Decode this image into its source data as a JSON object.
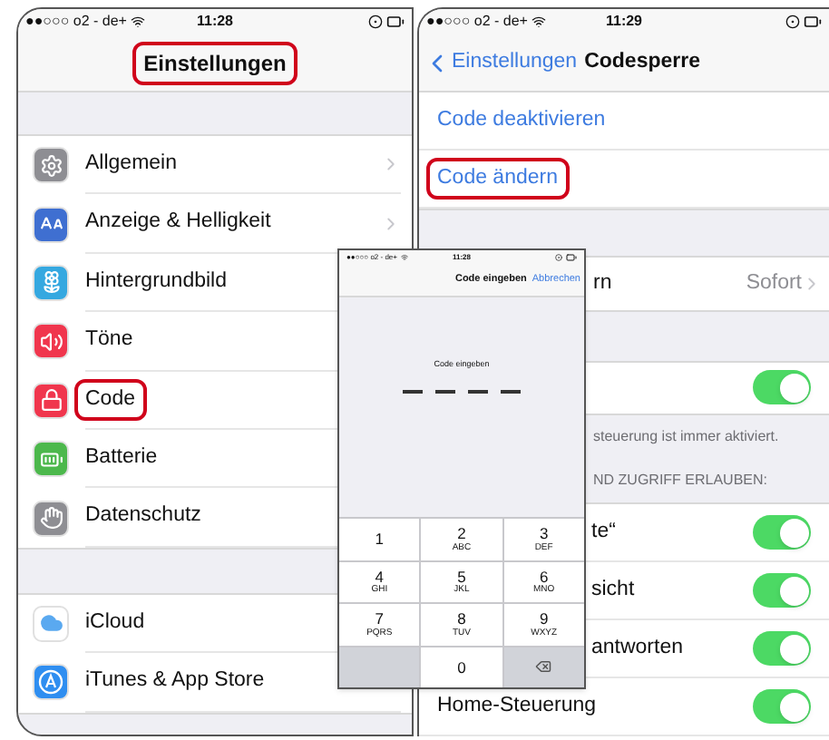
{
  "left_screen": {
    "status_bar": {
      "carrier": "●●○○○ o2 - de+",
      "time": "11:28"
    },
    "title": {
      "text": "Einstellungen",
      "highlighted": true
    },
    "sections": [
      {
        "items": [
          {
            "label": "Allgemein",
            "color": "#8e8e93",
            "chevron": true,
            "highlighted": false
          },
          {
            "label": "Anzeige & Helligkeit",
            "color": "#3f6fd1",
            "chevron": true,
            "highlighted": false
          },
          {
            "label": "Hintergrundbild",
            "color": "#35a8e0",
            "highlighted": false
          },
          {
            "label": "Töne",
            "color": "#f0364d",
            "highlighted": false
          },
          {
            "label": "Code",
            "color": "#f0364d",
            "highlighted": true
          },
          {
            "label": "Batterie",
            "color": "#4cb84c",
            "highlighted": false
          },
          {
            "label": "Datenschutz",
            "color": "#8e8e93",
            "highlighted": false
          }
        ]
      },
      {
        "items": [
          {
            "label": "iCloud",
            "color": "#ffffff",
            "highlighted": false
          },
          {
            "label": "iTunes & App Store",
            "color": "#2f8ef0",
            "highlighted": false
          }
        ]
      }
    ]
  },
  "right_screen": {
    "status_bar": {
      "carrier": "●●○○○ o2 - de+",
      "time": "11:29"
    },
    "back_label": "Einstellungen",
    "title": "Codesperre",
    "action_rows": [
      {
        "label": "Code deaktivieren",
        "highlighted": false
      },
      {
        "label": "Code ändern",
        "highlighted": true
      }
    ],
    "value_row": {
      "label": "rn",
      "value": "Sofort"
    },
    "toggle_row": {
      "on": true
    },
    "footer": "steuerung ist immer aktiviert.",
    "section_header": "ND ZUGRIFF ERLAUBEN:",
    "toggle_rows": [
      {
        "label": "te“",
        "on": true,
        "kind": "covered"
      },
      {
        "label": "sicht",
        "on": true,
        "kind": "covered"
      },
      {
        "label": "antworten",
        "on": true,
        "kind": "covered"
      },
      {
        "label": "Home-Steuerung",
        "on": true,
        "kind": "full"
      }
    ]
  },
  "code_dialog": {
    "status_bar": {
      "carrier": "●●○○○ o2 - de+",
      "time": "11:28"
    },
    "title": "Code eingeben",
    "cancel": "Abbrechen",
    "prompt": "Code eingeben",
    "code_slots": [
      {
        "filled": false
      },
      {
        "filled": false
      },
      {
        "filled": false
      },
      {
        "filled": false
      }
    ],
    "keys": [
      {
        "kind": "digit",
        "digit": "1"
      },
      {
        "kind": "digit",
        "digit": "2",
        "letters": "ABC"
      },
      {
        "kind": "digit",
        "digit": "3",
        "letters": "DEF"
      },
      {
        "kind": "digit",
        "digit": "4",
        "letters": "GHI"
      },
      {
        "kind": "digit",
        "digit": "5",
        "letters": "JKL"
      },
      {
        "kind": "digit",
        "digit": "6",
        "letters": "MNO"
      },
      {
        "kind": "digit",
        "digit": "7",
        "letters": "PQRS"
      },
      {
        "kind": "digit",
        "digit": "8",
        "letters": "TUV"
      },
      {
        "kind": "digit",
        "digit": "9",
        "letters": "WXYZ"
      },
      {
        "kind": "blank"
      },
      {
        "kind": "digit",
        "digit": "0"
      },
      {
        "kind": "delete"
      }
    ]
  }
}
